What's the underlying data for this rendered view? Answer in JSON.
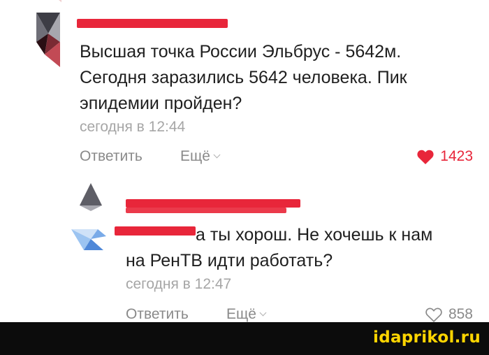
{
  "comments": [
    {
      "text_lines": [
        "Высшая точка России Эльбрус - 5642м.",
        "Сегодня заразились 5642 человека. Пик",
        "эпидемии пройден?"
      ],
      "time": "сегодня в 12:44",
      "reply_label": "Ответить",
      "more_label": "Ещё",
      "likes": "1423",
      "liked": true,
      "like_color": "#e8263a"
    },
    {
      "text_first_line": "а ты хорош. Не хочешь к нам",
      "text_lines": [
        "на РенТВ идти работать?"
      ],
      "time": "сегодня в 12:47",
      "reply_label": "Ответить",
      "more_label": "Ещё",
      "likes": "858",
      "liked": false
    }
  ],
  "footer": {
    "brand": "idaprikol.ru",
    "brand_color": "#ffd500"
  },
  "colors": {
    "accent": "#e8263a"
  }
}
